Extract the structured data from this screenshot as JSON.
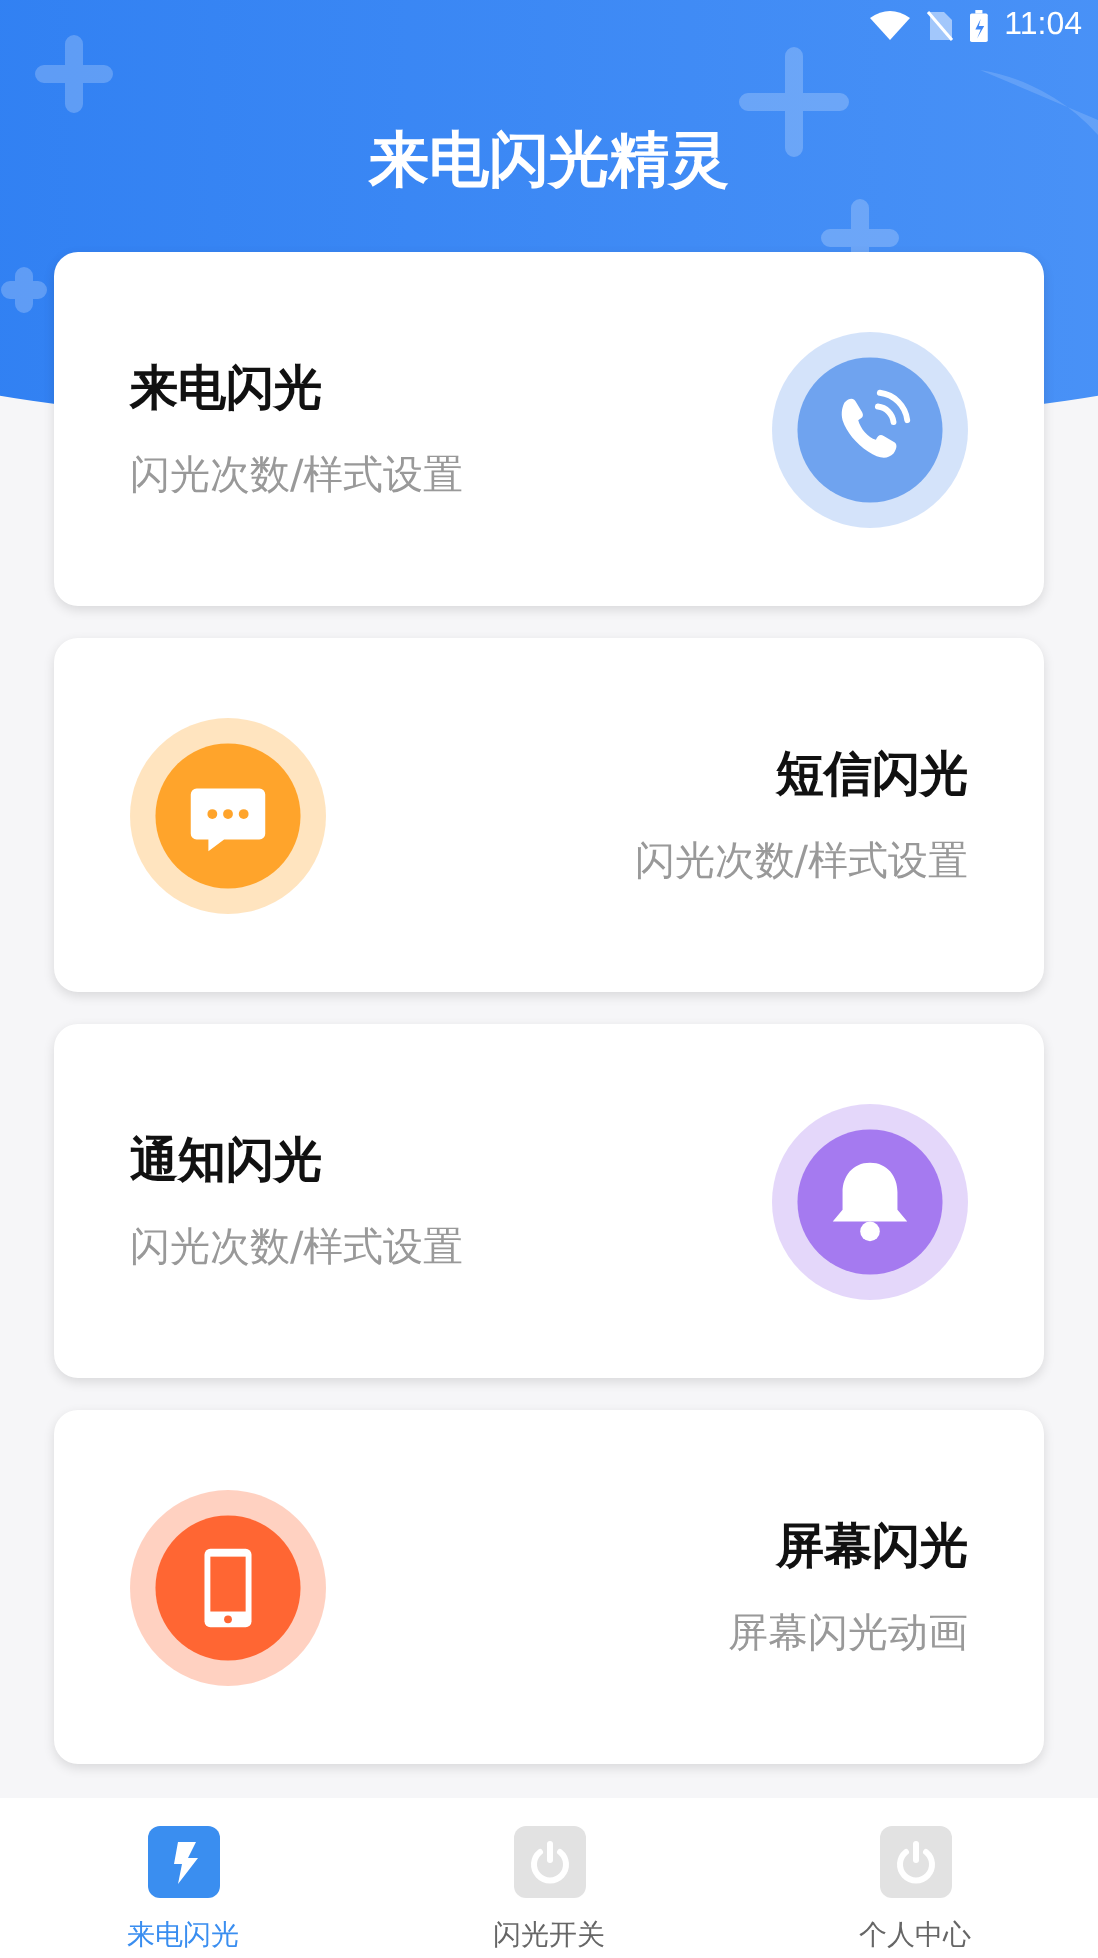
{
  "status_bar": {
    "time": "11:04"
  },
  "header": {
    "title": "来电闪光精灵"
  },
  "cards": [
    {
      "title": "来电闪光",
      "subtitle": "闪光次数/样式设置",
      "kind": "phone",
      "icon_left": false,
      "color": "#6fa3ef"
    },
    {
      "title": "短信闪光",
      "subtitle": "闪光次数/样式设置",
      "kind": "message",
      "icon_left": true,
      "color": "#ffa42b"
    },
    {
      "title": "通知闪光",
      "subtitle": "闪光次数/样式设置",
      "kind": "bell",
      "icon_left": false,
      "color": "#a57af0"
    },
    {
      "title": "屏幕闪光",
      "subtitle": "屏幕闪光动画",
      "kind": "mobile",
      "icon_left": true,
      "color": "#ff6633"
    }
  ],
  "tabs": [
    {
      "label": "来电闪光",
      "kind": "flash",
      "selected": true
    },
    {
      "label": "闪光开关",
      "kind": "power",
      "selected": false
    },
    {
      "label": "个人中心",
      "kind": "power",
      "selected": false
    }
  ]
}
